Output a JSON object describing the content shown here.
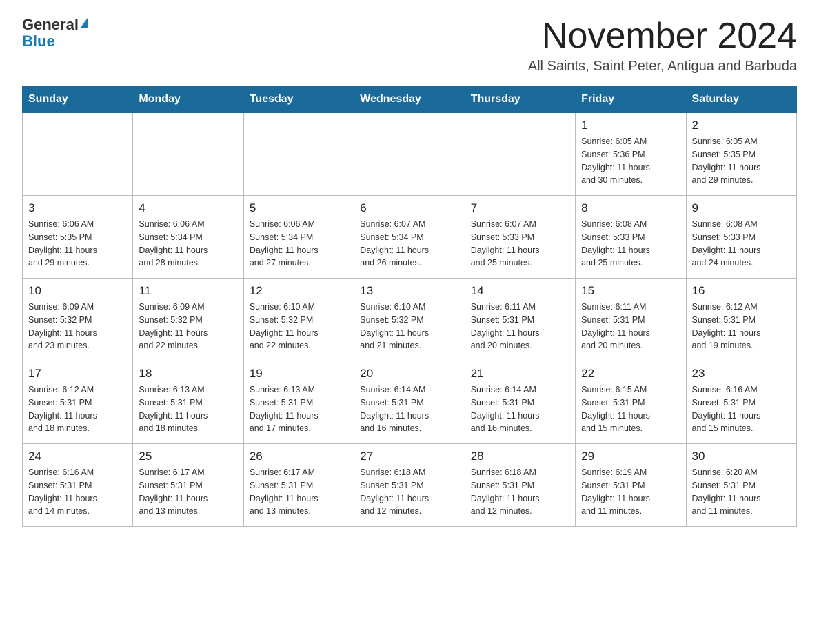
{
  "logo": {
    "general": "General",
    "blue": "Blue",
    "triangle": "▲"
  },
  "title": "November 2024",
  "subtitle": "All Saints, Saint Peter, Antigua and Barbuda",
  "days_of_week": [
    "Sunday",
    "Monday",
    "Tuesday",
    "Wednesday",
    "Thursday",
    "Friday",
    "Saturday"
  ],
  "weeks": [
    [
      {
        "day": "",
        "info": ""
      },
      {
        "day": "",
        "info": ""
      },
      {
        "day": "",
        "info": ""
      },
      {
        "day": "",
        "info": ""
      },
      {
        "day": "",
        "info": ""
      },
      {
        "day": "1",
        "info": "Sunrise: 6:05 AM\nSunset: 5:36 PM\nDaylight: 11 hours\nand 30 minutes."
      },
      {
        "day": "2",
        "info": "Sunrise: 6:05 AM\nSunset: 5:35 PM\nDaylight: 11 hours\nand 29 minutes."
      }
    ],
    [
      {
        "day": "3",
        "info": "Sunrise: 6:06 AM\nSunset: 5:35 PM\nDaylight: 11 hours\nand 29 minutes."
      },
      {
        "day": "4",
        "info": "Sunrise: 6:06 AM\nSunset: 5:34 PM\nDaylight: 11 hours\nand 28 minutes."
      },
      {
        "day": "5",
        "info": "Sunrise: 6:06 AM\nSunset: 5:34 PM\nDaylight: 11 hours\nand 27 minutes."
      },
      {
        "day": "6",
        "info": "Sunrise: 6:07 AM\nSunset: 5:34 PM\nDaylight: 11 hours\nand 26 minutes."
      },
      {
        "day": "7",
        "info": "Sunrise: 6:07 AM\nSunset: 5:33 PM\nDaylight: 11 hours\nand 25 minutes."
      },
      {
        "day": "8",
        "info": "Sunrise: 6:08 AM\nSunset: 5:33 PM\nDaylight: 11 hours\nand 25 minutes."
      },
      {
        "day": "9",
        "info": "Sunrise: 6:08 AM\nSunset: 5:33 PM\nDaylight: 11 hours\nand 24 minutes."
      }
    ],
    [
      {
        "day": "10",
        "info": "Sunrise: 6:09 AM\nSunset: 5:32 PM\nDaylight: 11 hours\nand 23 minutes."
      },
      {
        "day": "11",
        "info": "Sunrise: 6:09 AM\nSunset: 5:32 PM\nDaylight: 11 hours\nand 22 minutes."
      },
      {
        "day": "12",
        "info": "Sunrise: 6:10 AM\nSunset: 5:32 PM\nDaylight: 11 hours\nand 22 minutes."
      },
      {
        "day": "13",
        "info": "Sunrise: 6:10 AM\nSunset: 5:32 PM\nDaylight: 11 hours\nand 21 minutes."
      },
      {
        "day": "14",
        "info": "Sunrise: 6:11 AM\nSunset: 5:31 PM\nDaylight: 11 hours\nand 20 minutes."
      },
      {
        "day": "15",
        "info": "Sunrise: 6:11 AM\nSunset: 5:31 PM\nDaylight: 11 hours\nand 20 minutes."
      },
      {
        "day": "16",
        "info": "Sunrise: 6:12 AM\nSunset: 5:31 PM\nDaylight: 11 hours\nand 19 minutes."
      }
    ],
    [
      {
        "day": "17",
        "info": "Sunrise: 6:12 AM\nSunset: 5:31 PM\nDaylight: 11 hours\nand 18 minutes."
      },
      {
        "day": "18",
        "info": "Sunrise: 6:13 AM\nSunset: 5:31 PM\nDaylight: 11 hours\nand 18 minutes."
      },
      {
        "day": "19",
        "info": "Sunrise: 6:13 AM\nSunset: 5:31 PM\nDaylight: 11 hours\nand 17 minutes."
      },
      {
        "day": "20",
        "info": "Sunrise: 6:14 AM\nSunset: 5:31 PM\nDaylight: 11 hours\nand 16 minutes."
      },
      {
        "day": "21",
        "info": "Sunrise: 6:14 AM\nSunset: 5:31 PM\nDaylight: 11 hours\nand 16 minutes."
      },
      {
        "day": "22",
        "info": "Sunrise: 6:15 AM\nSunset: 5:31 PM\nDaylight: 11 hours\nand 15 minutes."
      },
      {
        "day": "23",
        "info": "Sunrise: 6:16 AM\nSunset: 5:31 PM\nDaylight: 11 hours\nand 15 minutes."
      }
    ],
    [
      {
        "day": "24",
        "info": "Sunrise: 6:16 AM\nSunset: 5:31 PM\nDaylight: 11 hours\nand 14 minutes."
      },
      {
        "day": "25",
        "info": "Sunrise: 6:17 AM\nSunset: 5:31 PM\nDaylight: 11 hours\nand 13 minutes."
      },
      {
        "day": "26",
        "info": "Sunrise: 6:17 AM\nSunset: 5:31 PM\nDaylight: 11 hours\nand 13 minutes."
      },
      {
        "day": "27",
        "info": "Sunrise: 6:18 AM\nSunset: 5:31 PM\nDaylight: 11 hours\nand 12 minutes."
      },
      {
        "day": "28",
        "info": "Sunrise: 6:18 AM\nSunset: 5:31 PM\nDaylight: 11 hours\nand 12 minutes."
      },
      {
        "day": "29",
        "info": "Sunrise: 6:19 AM\nSunset: 5:31 PM\nDaylight: 11 hours\nand 11 minutes."
      },
      {
        "day": "30",
        "info": "Sunrise: 6:20 AM\nSunset: 5:31 PM\nDaylight: 11 hours\nand 11 minutes."
      }
    ]
  ]
}
